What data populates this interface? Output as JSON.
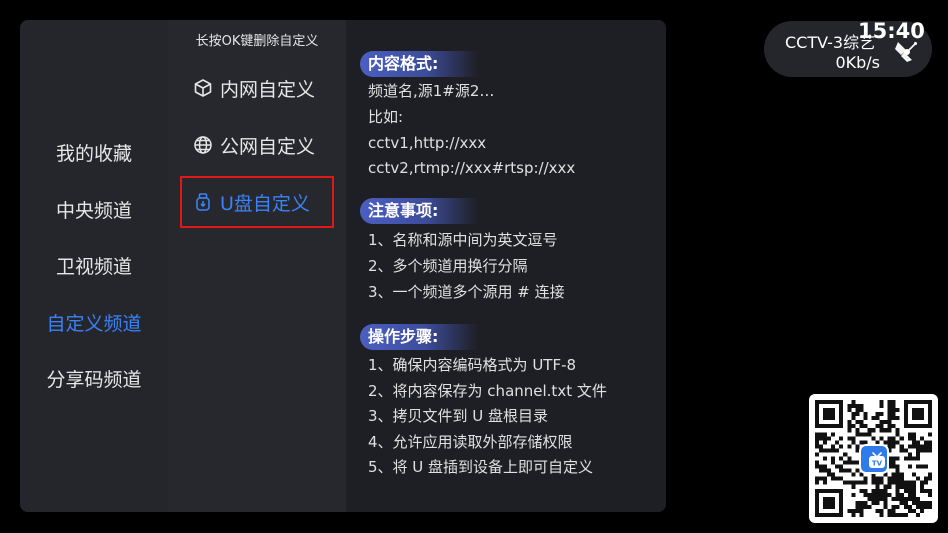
{
  "categories": [
    {
      "label": "我的收藏",
      "active": false
    },
    {
      "label": "中央频道",
      "active": false
    },
    {
      "label": "卫视频道",
      "active": false
    },
    {
      "label": "自定义频道",
      "active": true
    },
    {
      "label": "分享码频道",
      "active": false
    }
  ],
  "custom": {
    "hint": "长按OK键删除自定义",
    "items": [
      {
        "label": "内网自定义",
        "icon": "cube-icon"
      },
      {
        "label": "公网自定义",
        "icon": "globe-icon"
      },
      {
        "label": "U盘自定义",
        "icon": "usb-drive-icon"
      }
    ]
  },
  "info": {
    "format": {
      "title": "内容格式:",
      "lines": [
        "频道名,源1#源2…",
        "比如:",
        "cctv1,http://xxx",
        "cctv2,rtmp://xxx#rtsp://xxx"
      ]
    },
    "notes": {
      "title": "注意事项:",
      "lines": [
        "1、名称和源中间为英文逗号",
        "2、多个频道用换行分隔",
        "3、一个频道多个源用 # 连接"
      ]
    },
    "steps": {
      "title": "操作步骤:",
      "lines": [
        "1、确保内容编码格式为 UTF-8",
        "2、将内容保存为 channel.txt 文件",
        "3、拷贝文件到 U 盘根目录",
        "4、允许应用读取外部存储权限",
        "5、将 U 盘插到设备上即可自定义"
      ]
    }
  },
  "status": {
    "channel": "CCTV-3综艺",
    "speed": "0Kb/s",
    "clock": "15:40"
  },
  "colors": {
    "accent": "#3b82f6",
    "selection_border": "#e01818",
    "panel": "#26272d"
  }
}
